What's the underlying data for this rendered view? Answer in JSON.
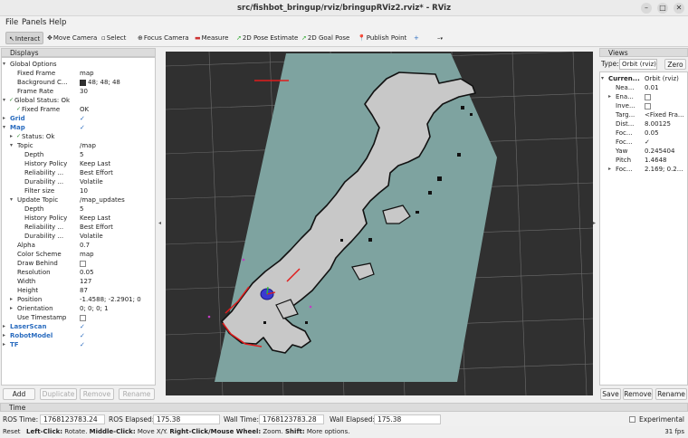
{
  "window": {
    "title": "src/fishbot_bringup/rviz/bringupRViz2.rviz* - RViz"
  },
  "menu": [
    "File",
    "Panels",
    "Help"
  ],
  "toolbar": {
    "tools": [
      {
        "label": "Interact",
        "icon": "interact-icon",
        "active": true
      },
      {
        "label": "Move Camera",
        "icon": "move-camera-icon"
      },
      {
        "label": "Select",
        "icon": "select-icon"
      },
      {
        "label": "Focus Camera",
        "icon": "focus-camera-icon"
      },
      {
        "label": "Measure",
        "icon": "measure-icon"
      },
      {
        "label": "2D Pose Estimate",
        "icon": "pose-estimate-icon"
      },
      {
        "label": "2D Goal Pose",
        "icon": "goal-pose-icon"
      },
      {
        "label": "Publish Point",
        "icon": "publish-point-icon"
      }
    ]
  },
  "displays": {
    "title": "Displays",
    "rows": [
      {
        "label": "Global Options",
        "indent": 1,
        "exp": "open",
        "icon": true
      },
      {
        "label": "Fixed Frame",
        "value": "map",
        "indent": 2
      },
      {
        "label": "Background C...",
        "value": "48; 48; 48",
        "indent": 2,
        "swatch": "#303030"
      },
      {
        "label": "Frame Rate",
        "value": "30",
        "indent": 2
      },
      {
        "label": "Global Status: Ok",
        "indent": 1,
        "exp": "open",
        "ok": true
      },
      {
        "label": "Fixed Frame",
        "value": "OK",
        "indent": 2,
        "ok": true
      },
      {
        "label": "Grid",
        "indent": 1,
        "exp": "closed",
        "blue": true,
        "check": true
      },
      {
        "label": "Map",
        "indent": 1,
        "exp": "open",
        "blue": true,
        "check": true
      },
      {
        "label": "Status: Ok",
        "indent": 2,
        "exp": "closed",
        "ok": true
      },
      {
        "label": "Topic",
        "value": "/map",
        "indent": 2,
        "exp": "open"
      },
      {
        "label": "Depth",
        "value": "5",
        "indent": 3
      },
      {
        "label": "History Policy",
        "value": "Keep Last",
        "indent": 3
      },
      {
        "label": "Reliability ...",
        "value": "Best Effort",
        "indent": 3
      },
      {
        "label": "Durability ...",
        "value": "Volatile",
        "indent": 3
      },
      {
        "label": "Filter size",
        "value": "10",
        "indent": 3
      },
      {
        "label": "Update Topic",
        "value": "/map_updates",
        "indent": 2,
        "exp": "open"
      },
      {
        "label": "Depth",
        "value": "5",
        "indent": 3
      },
      {
        "label": "History Policy",
        "value": "Keep Last",
        "indent": 3
      },
      {
        "label": "Reliability ...",
        "value": "Best Effort",
        "indent": 3
      },
      {
        "label": "Durability ...",
        "value": "Volatile",
        "indent": 3
      },
      {
        "label": "Alpha",
        "value": "0.7",
        "indent": 2
      },
      {
        "label": "Color Scheme",
        "value": "map",
        "indent": 2
      },
      {
        "label": "Draw Behind",
        "value": "",
        "indent": 2,
        "box": true
      },
      {
        "label": "Resolution",
        "value": "0.05",
        "indent": 2
      },
      {
        "label": "Width",
        "value": "127",
        "indent": 2
      },
      {
        "label": "Height",
        "value": "87",
        "indent": 2
      },
      {
        "label": "Position",
        "value": "-1.4588; -2.2901; 0",
        "indent": 2,
        "exp": "closed"
      },
      {
        "label": "Orientation",
        "value": "0; 0; 0; 1",
        "indent": 2,
        "exp": "closed"
      },
      {
        "label": "Use Timestamp",
        "value": "",
        "indent": 2,
        "box": true
      },
      {
        "label": "LaserScan",
        "indent": 1,
        "exp": "closed",
        "blue": true,
        "check": true
      },
      {
        "label": "RobotModel",
        "indent": 1,
        "exp": "closed",
        "blue": true,
        "check": true
      },
      {
        "label": "TF",
        "indent": 1,
        "exp": "closed",
        "blue": true,
        "check": true
      }
    ],
    "buttons": {
      "add": "Add",
      "duplicate": "Duplicate",
      "remove": "Remove",
      "rename": "Rename"
    }
  },
  "views": {
    "title": "Views",
    "type_label": "Type:",
    "type_value": "Orbit (rviz)",
    "zero": "Zero",
    "rows": [
      {
        "label": "Curren...",
        "value": "Orbit (rviz)",
        "bold": true,
        "exp": "open"
      },
      {
        "label": "Nea...",
        "value": "0.01",
        "indent": 2
      },
      {
        "label": "Ena...",
        "value": "",
        "indent": 2,
        "exp": "closed",
        "box": true
      },
      {
        "label": "Inve...",
        "value": "",
        "indent": 2,
        "box": true
      },
      {
        "label": "Targ...",
        "value": "<Fixed Fra...",
        "indent": 2
      },
      {
        "label": "Dist...",
        "value": "8.00125",
        "indent": 2
      },
      {
        "label": "Foc...",
        "value": "0.05",
        "indent": 2
      },
      {
        "label": "Foc...",
        "value": "✓",
        "indent": 2
      },
      {
        "label": "Yaw",
        "value": "0.245404",
        "indent": 2
      },
      {
        "label": "Pitch",
        "value": "1.4648",
        "indent": 2
      },
      {
        "label": "Foc...",
        "value": "2.169; 0.2...",
        "indent": 2,
        "exp": "closed"
      }
    ],
    "buttons": {
      "save": "Save",
      "remove": "Remove",
      "rename": "Rename"
    }
  },
  "time": {
    "title": "Time",
    "ros_time_label": "ROS Time:",
    "ros_time": "1768123783.24",
    "ros_elapsed_label": "ROS Elapsed:",
    "ros_elapsed": "175.38",
    "wall_time_label": "Wall Time:",
    "wall_time": "1768123783.28",
    "wall_elapsed_label": "Wall Elapsed:",
    "wall_elapsed": "175.38",
    "experimental": "Experimental"
  },
  "status": {
    "reset": "Reset",
    "hint_1_bold": "Left-Click:",
    "hint_1": " Rotate. ",
    "hint_2_bold": "Middle-Click:",
    "hint_2": " Move X/Y. ",
    "hint_3_bold": "Right-Click/Mouse Wheel:",
    "hint_3": " Zoom. ",
    "hint_4_bold": "Shift:",
    "hint_4": " More options.",
    "fps": "31 fps"
  },
  "colors": {
    "viewport_bg": "#303030",
    "map_free": "#c8c8c8",
    "map_unknown": "#7ea3a0",
    "laser": "#e01c1c",
    "accent_blue": "#2a6cbf"
  }
}
